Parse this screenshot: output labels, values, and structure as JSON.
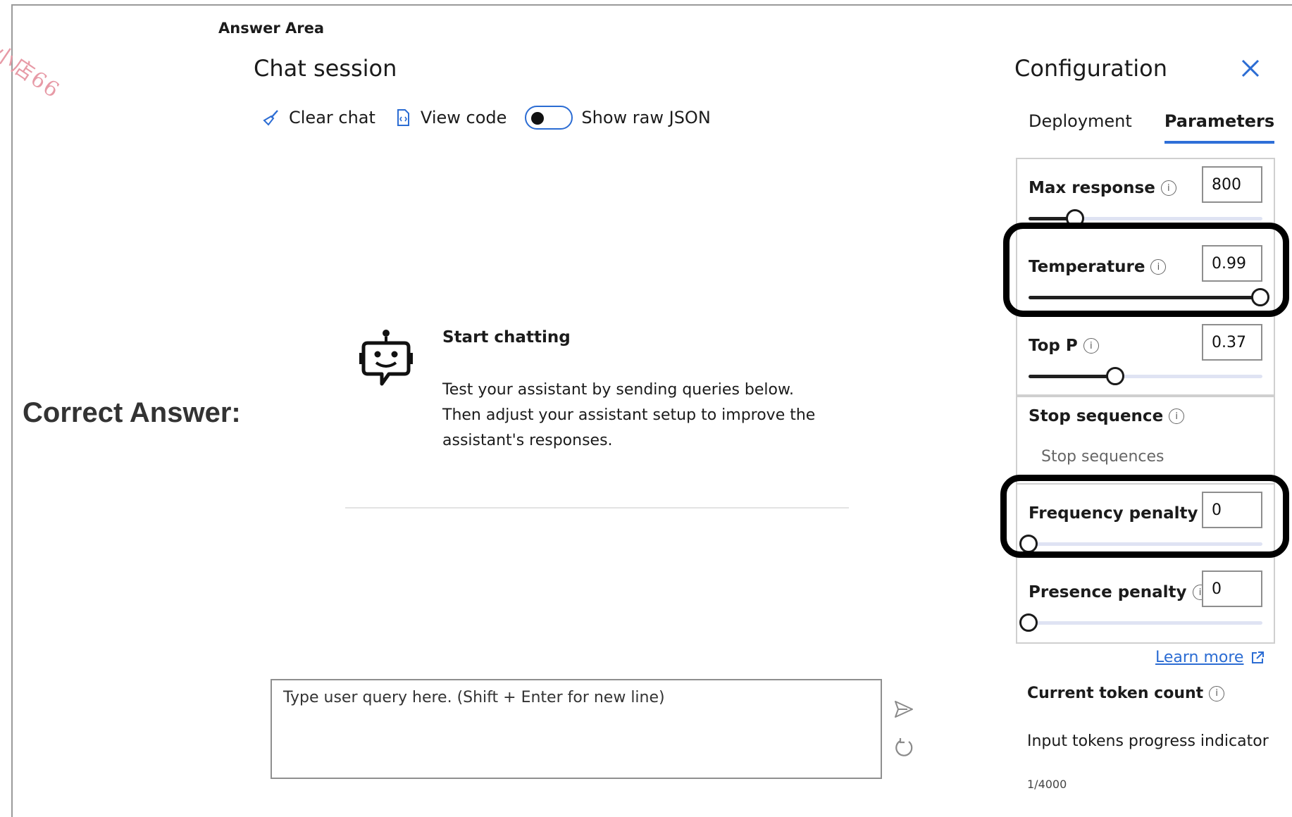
{
  "header": {
    "answer_area": "Answer Area",
    "correct_answer": "Correct Answer:",
    "watermark": "小店66"
  },
  "chat": {
    "title": "Chat session",
    "toolbar": {
      "clear_chat": "Clear chat",
      "view_code": "View code",
      "show_raw_json": "Show raw JSON",
      "show_raw_json_on": false
    },
    "empty_state": {
      "title": "Start chatting",
      "description": "Test your assistant by sending queries below. Then adjust your assistant setup to improve the assistant's responses."
    },
    "query_placeholder": "Type user query here. (Shift + Enter for new line)"
  },
  "config": {
    "title": "Configuration",
    "tabs": [
      {
        "label": "Deployment",
        "active": false
      },
      {
        "label": "Parameters",
        "active": true
      }
    ],
    "params": {
      "max_response": {
        "label": "Max response",
        "value": "800",
        "slider_fraction": 0.2
      },
      "temperature": {
        "label": "Temperature",
        "value": "0.99",
        "slider_fraction": 0.99
      },
      "top_p": {
        "label": "Top P",
        "value": "0.37",
        "slider_fraction": 0.37
      },
      "stop_sequence": {
        "label": "Stop sequence",
        "placeholder": "Stop sequences"
      },
      "frequency_penalty": {
        "label": "Frequency penalty",
        "value": "0",
        "slider_fraction": 0
      },
      "presence_penalty": {
        "label": "Presence penalty",
        "value": "0",
        "slider_fraction": 0
      }
    },
    "learn_more": "Learn more",
    "token": {
      "title": "Current token count",
      "progress_label": "Input tokens progress indicator",
      "count": "1/4000"
    }
  },
  "colors": {
    "accent": "#2b6cd3",
    "highlight": "#000000"
  }
}
